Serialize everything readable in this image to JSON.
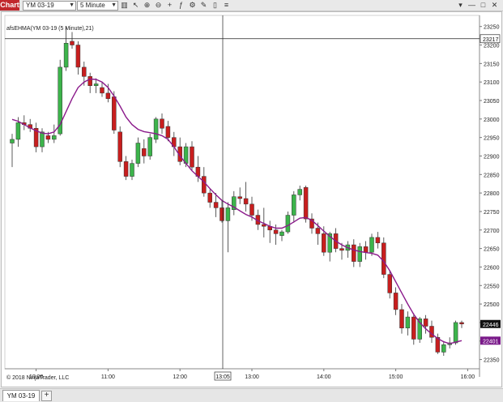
{
  "toolbar": {
    "app_label": "Chart",
    "instrument": "YM 03-19",
    "interval": "5 Minute",
    "tools": [
      {
        "name": "bar-chart-icon",
        "glyph": "▥"
      },
      {
        "name": "pointer-icon",
        "glyph": "↖"
      },
      {
        "name": "zoom-in-icon",
        "glyph": "⊕"
      },
      {
        "name": "zoom-out-icon",
        "glyph": "⊖"
      },
      {
        "name": "crosshair-icon",
        "glyph": "+"
      },
      {
        "name": "indicators-icon",
        "glyph": "ƒ"
      },
      {
        "name": "strategies-icon",
        "glyph": "⚙"
      },
      {
        "name": "drawing-tools-icon",
        "glyph": "✎"
      },
      {
        "name": "hide-drawings-icon",
        "glyph": "▯"
      },
      {
        "name": "properties-icon",
        "glyph": "≡"
      }
    ],
    "window_buttons": [
      "▾",
      "—",
      "□",
      "✕"
    ]
  },
  "indicator_label": "afsEHMA(YM 03-19 (5 Minute),21)",
  "copyright": "© 2018 NinjaTrader, LLC",
  "tab": {
    "label": "YM 03-19",
    "add_label": "+"
  },
  "colors": {
    "up": "#3cb44b",
    "down": "#c81e1e",
    "hma": "#8b1a8b",
    "crosshair": "#222222",
    "price_tag": "#111111",
    "hma_tag": "#7a1a8a"
  },
  "chart_data": {
    "type": "candlestick",
    "y_ticks": [
      23250,
      23200,
      23150,
      23100,
      23050,
      23000,
      22950,
      22900,
      22850,
      22800,
      22750,
      22700,
      22650,
      22600,
      22550,
      22500,
      22450,
      22400,
      22350
    ],
    "y_range": [
      22325,
      23280
    ],
    "x_ticks": [
      "10:00",
      "11:00",
      "12:00",
      "13:00",
      "14:00",
      "15:00",
      "16:00"
    ],
    "crosshair": {
      "price": "23217",
      "time": "13:05"
    },
    "last_price": "22446",
    "hma_value": "22401",
    "candles": [
      {
        "o": 22935,
        "h": 22960,
        "l": 22870,
        "c": 22945
      },
      {
        "o": 22945,
        "h": 23005,
        "l": 22925,
        "c": 22990
      },
      {
        "o": 22990,
        "h": 23010,
        "l": 22970,
        "c": 22985
      },
      {
        "o": 22985,
        "h": 23000,
        "l": 22965,
        "c": 22975
      },
      {
        "o": 22975,
        "h": 22990,
        "l": 22910,
        "c": 22925
      },
      {
        "o": 22925,
        "h": 22975,
        "l": 22910,
        "c": 22965
      },
      {
        "o": 22955,
        "h": 22965,
        "l": 22935,
        "c": 22945
      },
      {
        "o": 22945,
        "h": 22985,
        "l": 22935,
        "c": 22955
      },
      {
        "o": 22960,
        "h": 23160,
        "l": 22955,
        "c": 23140
      },
      {
        "o": 23140,
        "h": 23250,
        "l": 23130,
        "c": 23205
      },
      {
        "o": 23210,
        "h": 23235,
        "l": 23190,
        "c": 23200
      },
      {
        "o": 23200,
        "h": 23210,
        "l": 23120,
        "c": 23140
      },
      {
        "o": 23140,
        "h": 23155,
        "l": 23090,
        "c": 23115
      },
      {
        "o": 23115,
        "h": 23125,
        "l": 23070,
        "c": 23090
      },
      {
        "o": 23090,
        "h": 23110,
        "l": 23070,
        "c": 23095
      },
      {
        "o": 23085,
        "h": 23100,
        "l": 23060,
        "c": 23070
      },
      {
        "o": 23070,
        "h": 23095,
        "l": 23045,
        "c": 23055
      },
      {
        "o": 23060,
        "h": 23075,
        "l": 22960,
        "c": 22970
      },
      {
        "o": 22965,
        "h": 22980,
        "l": 22870,
        "c": 22885
      },
      {
        "o": 22885,
        "h": 22900,
        "l": 22835,
        "c": 22845
      },
      {
        "o": 22845,
        "h": 22890,
        "l": 22835,
        "c": 22880
      },
      {
        "o": 22880,
        "h": 22950,
        "l": 22870,
        "c": 22935
      },
      {
        "o": 22920,
        "h": 22945,
        "l": 22880,
        "c": 22900
      },
      {
        "o": 22900,
        "h": 22960,
        "l": 22890,
        "c": 22950
      },
      {
        "o": 22945,
        "h": 23005,
        "l": 22935,
        "c": 23000
      },
      {
        "o": 23000,
        "h": 23015,
        "l": 22960,
        "c": 22975
      },
      {
        "o": 22980,
        "h": 22995,
        "l": 22940,
        "c": 22950
      },
      {
        "o": 22950,
        "h": 22965,
        "l": 22900,
        "c": 22925
      },
      {
        "o": 22925,
        "h": 22950,
        "l": 22875,
        "c": 22885
      },
      {
        "o": 22880,
        "h": 22935,
        "l": 22870,
        "c": 22925
      },
      {
        "o": 22925,
        "h": 22940,
        "l": 22860,
        "c": 22870
      },
      {
        "o": 22870,
        "h": 22900,
        "l": 22830,
        "c": 22845
      },
      {
        "o": 22845,
        "h": 22870,
        "l": 22790,
        "c": 22800
      },
      {
        "o": 22800,
        "h": 22810,
        "l": 22760,
        "c": 22775
      },
      {
        "o": 22775,
        "h": 22800,
        "l": 22735,
        "c": 22760
      },
      {
        "o": 22760,
        "h": 22780,
        "l": 22720,
        "c": 22725
      },
      {
        "o": 22725,
        "h": 22775,
        "l": 22640,
        "c": 22760
      },
      {
        "o": 22755,
        "h": 22805,
        "l": 22740,
        "c": 22790
      },
      {
        "o": 22790,
        "h": 22815,
        "l": 22770,
        "c": 22785
      },
      {
        "o": 22785,
        "h": 22830,
        "l": 22750,
        "c": 22770
      },
      {
        "o": 22770,
        "h": 22790,
        "l": 22725,
        "c": 22740
      },
      {
        "o": 22740,
        "h": 22755,
        "l": 22700,
        "c": 22715
      },
      {
        "o": 22715,
        "h": 22760,
        "l": 22680,
        "c": 22710
      },
      {
        "o": 22710,
        "h": 22725,
        "l": 22665,
        "c": 22700
      },
      {
        "o": 22700,
        "h": 22715,
        "l": 22660,
        "c": 22690
      },
      {
        "o": 22685,
        "h": 22700,
        "l": 22670,
        "c": 22695
      },
      {
        "o": 22695,
        "h": 22750,
        "l": 22690,
        "c": 22740
      },
      {
        "o": 22740,
        "h": 22805,
        "l": 22720,
        "c": 22795
      },
      {
        "o": 22795,
        "h": 22820,
        "l": 22780,
        "c": 22810
      },
      {
        "o": 22815,
        "h": 22820,
        "l": 22720,
        "c": 22730
      },
      {
        "o": 22730,
        "h": 22745,
        "l": 22690,
        "c": 22705
      },
      {
        "o": 22705,
        "h": 22720,
        "l": 22660,
        "c": 22690
      },
      {
        "o": 22690,
        "h": 22710,
        "l": 22630,
        "c": 22640
      },
      {
        "o": 22640,
        "h": 22695,
        "l": 22615,
        "c": 22690
      },
      {
        "o": 22690,
        "h": 22705,
        "l": 22640,
        "c": 22650
      },
      {
        "o": 22650,
        "h": 22665,
        "l": 22620,
        "c": 22645
      },
      {
        "o": 22645,
        "h": 22670,
        "l": 22625,
        "c": 22660
      },
      {
        "o": 22660,
        "h": 22675,
        "l": 22600,
        "c": 22615
      },
      {
        "o": 22615,
        "h": 22665,
        "l": 22600,
        "c": 22655
      },
      {
        "o": 22655,
        "h": 22670,
        "l": 22620,
        "c": 22640
      },
      {
        "o": 22640,
        "h": 22690,
        "l": 22630,
        "c": 22680
      },
      {
        "o": 22680,
        "h": 22695,
        "l": 22650,
        "c": 22665
      },
      {
        "o": 22665,
        "h": 22680,
        "l": 22570,
        "c": 22580
      },
      {
        "o": 22580,
        "h": 22590,
        "l": 22515,
        "c": 22530
      },
      {
        "o": 22530,
        "h": 22545,
        "l": 22470,
        "c": 22485
      },
      {
        "o": 22485,
        "h": 22500,
        "l": 22420,
        "c": 22435
      },
      {
        "o": 22435,
        "h": 22480,
        "l": 22415,
        "c": 22465
      },
      {
        "o": 22465,
        "h": 22475,
        "l": 22390,
        "c": 22405
      },
      {
        "o": 22405,
        "h": 22465,
        "l": 22395,
        "c": 22460
      },
      {
        "o": 22460,
        "h": 22470,
        "l": 22420,
        "c": 22440
      },
      {
        "o": 22440,
        "h": 22455,
        "l": 22395,
        "c": 22410
      },
      {
        "o": 22410,
        "h": 22420,
        "l": 22365,
        "c": 22370
      },
      {
        "o": 22370,
        "h": 22400,
        "l": 22360,
        "c": 22390
      },
      {
        "o": 22390,
        "h": 22410,
        "l": 22380,
        "c": 22395
      },
      {
        "o": 22395,
        "h": 22455,
        "l": 22390,
        "c": 22450
      },
      {
        "o": 22450,
        "h": 22455,
        "l": 22435,
        "c": 22446
      }
    ],
    "hma": [
      22999,
      22994,
      22985,
      22976,
      22968,
      22962,
      22960,
      22965,
      22985,
      23020,
      23055,
      23085,
      23100,
      23108,
      23107,
      23100,
      23085,
      23062,
      23035,
      23005,
      22985,
      22972,
      22966,
      22963,
      22960,
      22955,
      22945,
      22925,
      22900,
      22880,
      22860,
      22845,
      22830,
      22812,
      22795,
      22780,
      22770,
      22762,
      22752,
      22742,
      22735,
      22725,
      22718,
      22710,
      22705,
      22705,
      22712,
      22722,
      22732,
      22734,
      22726,
      22712,
      22697,
      22683,
      22670,
      22660,
      22652,
      22646,
      22642,
      22639,
      22637,
      22632,
      22615,
      22590,
      22560,
      22530,
      22500,
      22472,
      22450,
      22433,
      22419,
      22407,
      22398,
      22393,
      22397,
      22401
    ]
  }
}
